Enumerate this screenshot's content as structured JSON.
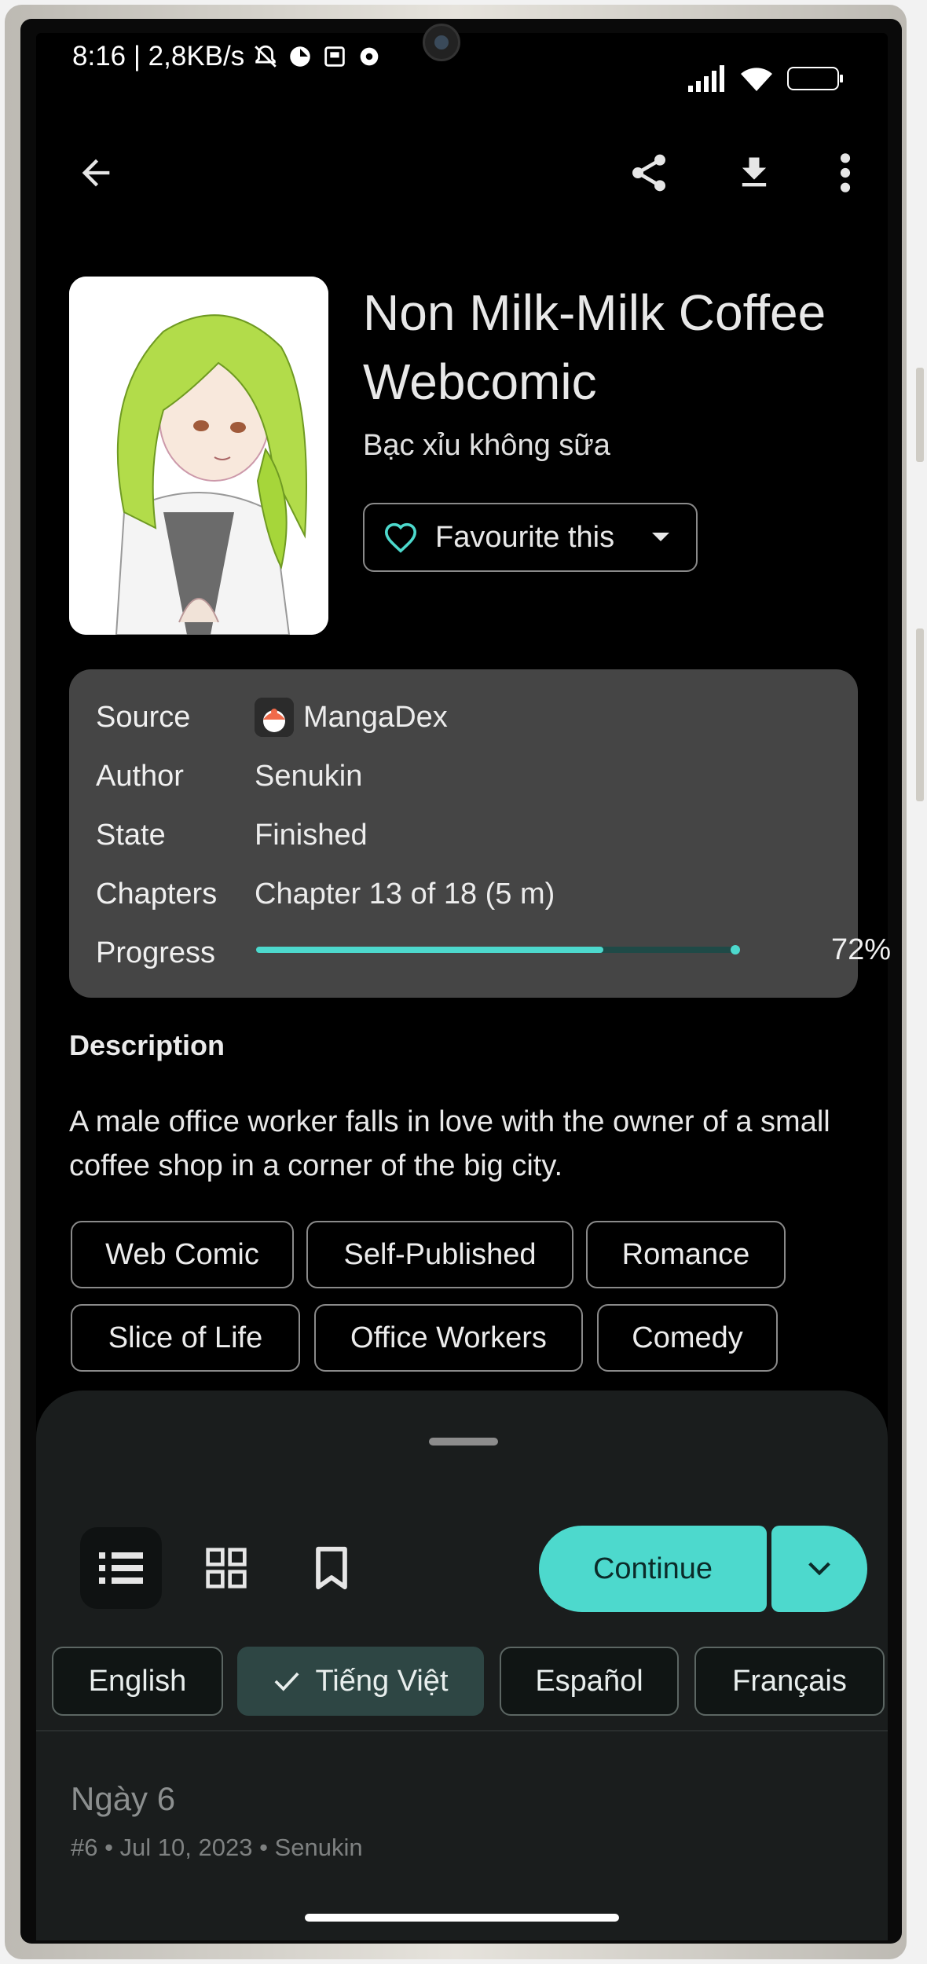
{
  "status_bar": {
    "time_speed": "8:16 | 2,8KB/s",
    "battery": "100"
  },
  "app_bar": {
    "icons": [
      "back-arrow-icon",
      "share-icon",
      "download-icon",
      "more-vert-icon"
    ]
  },
  "manga": {
    "title": "Non Milk-Milk Coffee Webcomic",
    "alt_title": "Bạc xỉu không sữa",
    "favourite_label": "Favourite this"
  },
  "info": {
    "source_label": "Source",
    "source_value": "MangaDex",
    "author_label": "Author",
    "author_value": "Senukin",
    "state_label": "State",
    "state_value": "Finished",
    "chapters_label": "Chapters",
    "chapters_value": "Chapter 13 of 18 (5 m)",
    "progress_label": "Progress",
    "progress_value": 0.72,
    "progress_text": "72%"
  },
  "description": {
    "heading": "Description",
    "text": "A male office worker falls in love with the owner of a small coffee shop in a corner of the big city."
  },
  "tags": [
    "Web Comic",
    "Self-Published",
    "Romance",
    "Slice of Life",
    "Office Workers",
    "Comedy"
  ],
  "sheet": {
    "continue_label": "Continue",
    "languages": [
      "English",
      "Tiếng Việt",
      "Español",
      "Français"
    ],
    "selected_language": "Tiếng Việt"
  },
  "chapter_list": [
    {
      "title": "Ngày 6",
      "meta": "#6 • Jul 10, 2023 • Senukin"
    }
  ],
  "colors": {
    "accent": "#4dd9cd",
    "card_bg": "#454545",
    "sheet_bg": "#1a1d1d"
  }
}
